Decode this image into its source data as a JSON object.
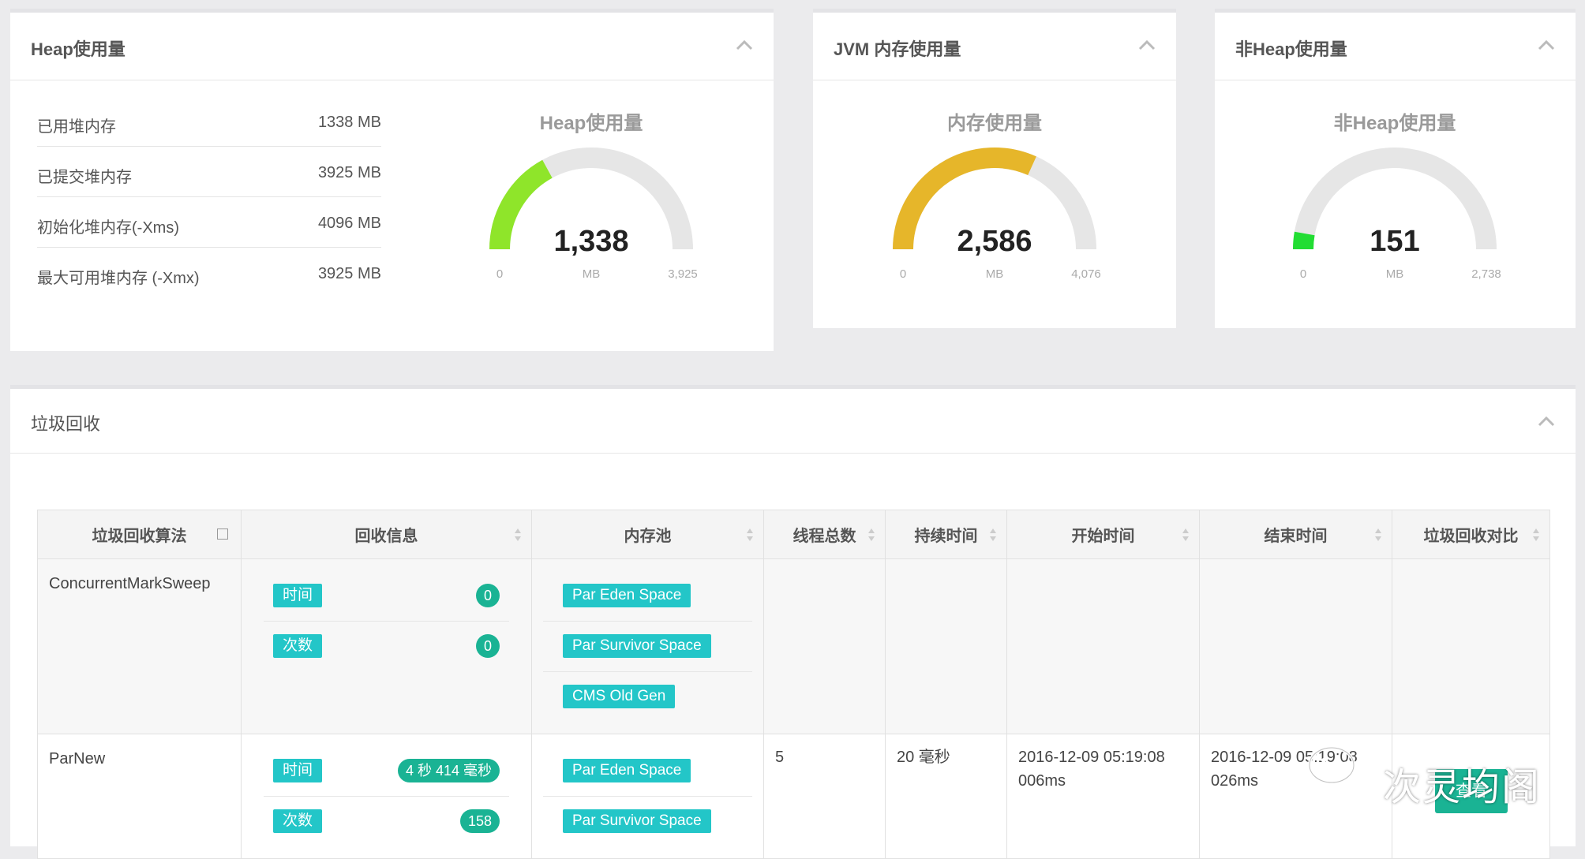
{
  "heap_panel": {
    "title": "Heap使用量",
    "rows": [
      {
        "label": "已用堆内存",
        "value": "1338 MB"
      },
      {
        "label": "已提交堆内存",
        "value": "3925 MB"
      },
      {
        "label": "初始化堆内存(-Xms)",
        "value": "4096 MB"
      },
      {
        "label": "最大可用堆内存 (-Xmx)",
        "value": "3925 MB"
      }
    ],
    "gauge": {
      "title": "Heap使用量",
      "value": 1338,
      "value_label": "1,338",
      "unit": "MB",
      "min": 0,
      "min_label": "0",
      "max": 3925,
      "max_label": "3,925",
      "color": "#8fe52a"
    }
  },
  "jvm_panel": {
    "title": "JVM 内存使用量",
    "gauge": {
      "title": "内存使用量",
      "value": 2586,
      "value_label": "2,586",
      "unit": "MB",
      "min": 0,
      "min_label": "0",
      "max": 4076,
      "max_label": "4,076",
      "color": "#e6b62a"
    }
  },
  "nonheap_panel": {
    "title": "非Heap使用量",
    "gauge": {
      "title": "非Heap使用量",
      "value": 151,
      "value_label": "151",
      "unit": "MB",
      "min": 0,
      "min_label": "0",
      "max": 2738,
      "max_label": "2,738",
      "color": "#22dd33"
    }
  },
  "gc_panel": {
    "title": "垃圾回收",
    "columns": [
      "垃圾回收算法",
      "回收信息",
      "内存池",
      "线程总数",
      "持续时间",
      "开始时间",
      "结束时间",
      "垃圾回收对比"
    ],
    "rows": [
      {
        "algorithm": "ConcurrentMarkSweep",
        "info": [
          {
            "label": "时间",
            "value": "0"
          },
          {
            "label": "次数",
            "value": "0"
          }
        ],
        "pools": [
          "Par Eden Space",
          "Par Survivor Space",
          "CMS Old Gen"
        ],
        "threads": "",
        "duration": "",
        "start": "",
        "end": ""
      },
      {
        "algorithm": "ParNew",
        "info": [
          {
            "label": "时间",
            "value": "4 秒 414 毫秒"
          },
          {
            "label": "次数",
            "value": "158"
          }
        ],
        "pools": [
          "Par Eden Space",
          "Par Survivor Space"
        ],
        "threads": "5",
        "duration": "20 毫秒",
        "start": "2016-12-09 05:19:08 006ms",
        "end": "2016-12-09 05:19:08 026ms",
        "compare_button": "查看"
      }
    ]
  },
  "watermark": {
    "text": "次灵均阁",
    "icon": "wechat-icon"
  },
  "colors": {
    "accent_tag": "#23c6c8",
    "accent_pill": "#1ab394",
    "gauge_track": "#e6e6e6"
  }
}
